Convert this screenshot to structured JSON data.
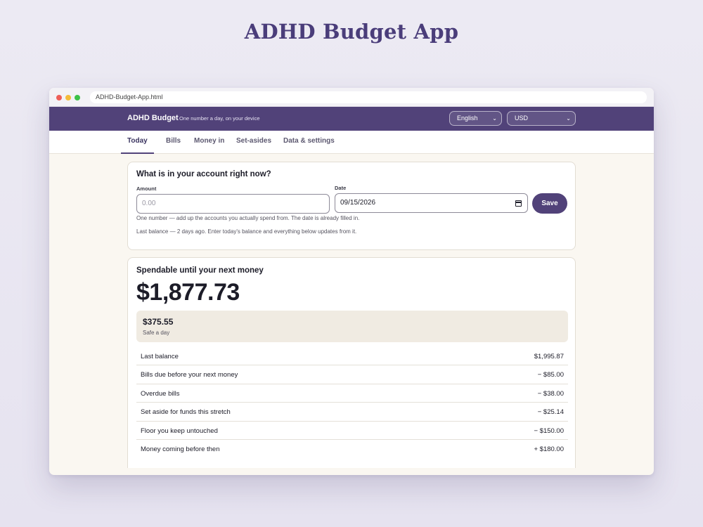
{
  "page_title": "ADHD Budget App",
  "browser": {
    "address": "ADHD-Budget-App.html"
  },
  "header": {
    "brand": "ADHD Budget",
    "tagline": "One number a day, on your device",
    "language": "English",
    "currency": "USD"
  },
  "tabs": [
    {
      "label": "Today",
      "active": true
    },
    {
      "label": "Bills",
      "active": false
    },
    {
      "label": "Money in",
      "active": false
    },
    {
      "label": "Set-asides",
      "active": false
    },
    {
      "label": "Data & settings",
      "active": false
    }
  ],
  "balance_card": {
    "heading": "What is in your account right now?",
    "amount_label": "Amount",
    "amount_placeholder": "0.00",
    "date_label": "Date",
    "date_value": "09/15/2026",
    "save_label": "Save",
    "help_text": "One number — add up the accounts you actually spend from. The date is already filled in.",
    "last_balance_note": "Last balance — 2 days ago. Enter today's balance and everything below updates from it."
  },
  "spendable_card": {
    "heading": "Spendable until your next money",
    "amount": "$1,877.73",
    "safe_amount": "$375.55",
    "safe_label": "Safe a day",
    "rows": [
      {
        "label": "Last balance",
        "value": "$1,995.87"
      },
      {
        "label": "Bills due before your next money",
        "value": "− $85.00"
      },
      {
        "label": "Overdue bills",
        "value": "− $38.00"
      },
      {
        "label": "Set aside for funds this stretch",
        "value": "− $25.14"
      },
      {
        "label": "Floor you keep untouched",
        "value": "− $150.00"
      },
      {
        "label": "Money coming before then",
        "value": "+ $180.00"
      }
    ]
  },
  "colors": {
    "brand": "#514279",
    "title": "#4a3d7a",
    "page_bg": "#faf7f1",
    "safe_box": "#f0ebe2"
  }
}
